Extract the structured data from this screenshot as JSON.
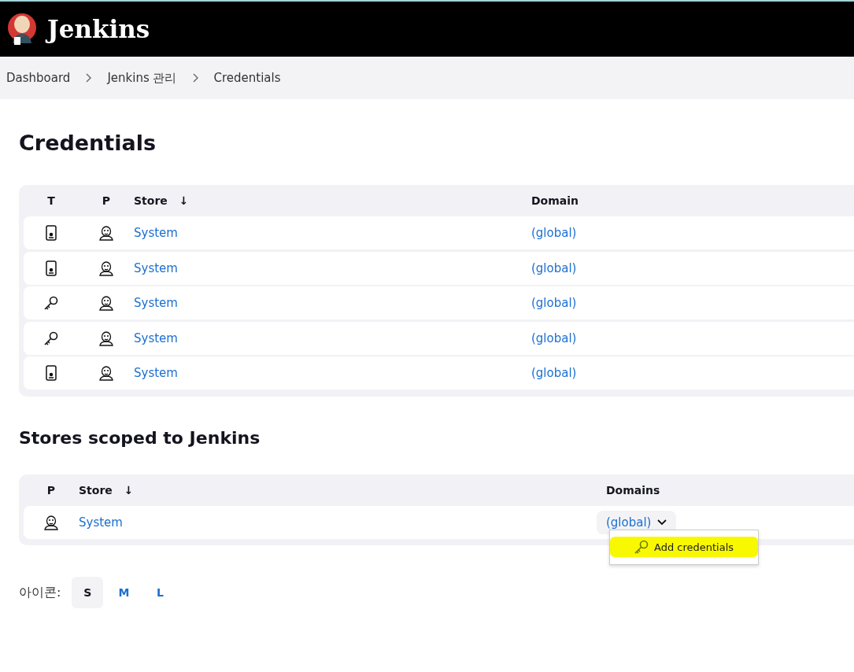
{
  "header": {
    "title": "Jenkins"
  },
  "breadcrumbs": [
    {
      "label": "Dashboard"
    },
    {
      "label": "Jenkins 관리"
    },
    {
      "label": "Credentials"
    }
  ],
  "page_title": "Credentials",
  "credentials_table": {
    "columns": [
      "T",
      "P",
      "Store",
      "Domain"
    ],
    "sort_indicator": "↓",
    "rows": [
      {
        "kind": "device",
        "store": "System",
        "domain": "(global)"
      },
      {
        "kind": "device",
        "store": "System",
        "domain": "(global)"
      },
      {
        "kind": "key",
        "store": "System",
        "domain": "(global)"
      },
      {
        "kind": "key",
        "store": "System",
        "domain": "(global)"
      },
      {
        "kind": "device",
        "store": "System",
        "domain": "(global)"
      }
    ]
  },
  "stores_title": "Stores scoped to Jenkins",
  "stores_table": {
    "columns": [
      "P",
      "Store",
      "Domains"
    ],
    "sort_indicator": "↓",
    "rows": [
      {
        "store": "System",
        "domain": "(global)",
        "menu": {
          "open": true,
          "items": [
            {
              "label": "Add credentials",
              "highlighted": true
            }
          ]
        }
      }
    ]
  },
  "icon_size": {
    "label": "아이콘:",
    "options": [
      {
        "label": "S",
        "selected": true
      },
      {
        "label": "M",
        "selected": false
      },
      {
        "label": "L",
        "selected": false
      }
    ]
  }
}
